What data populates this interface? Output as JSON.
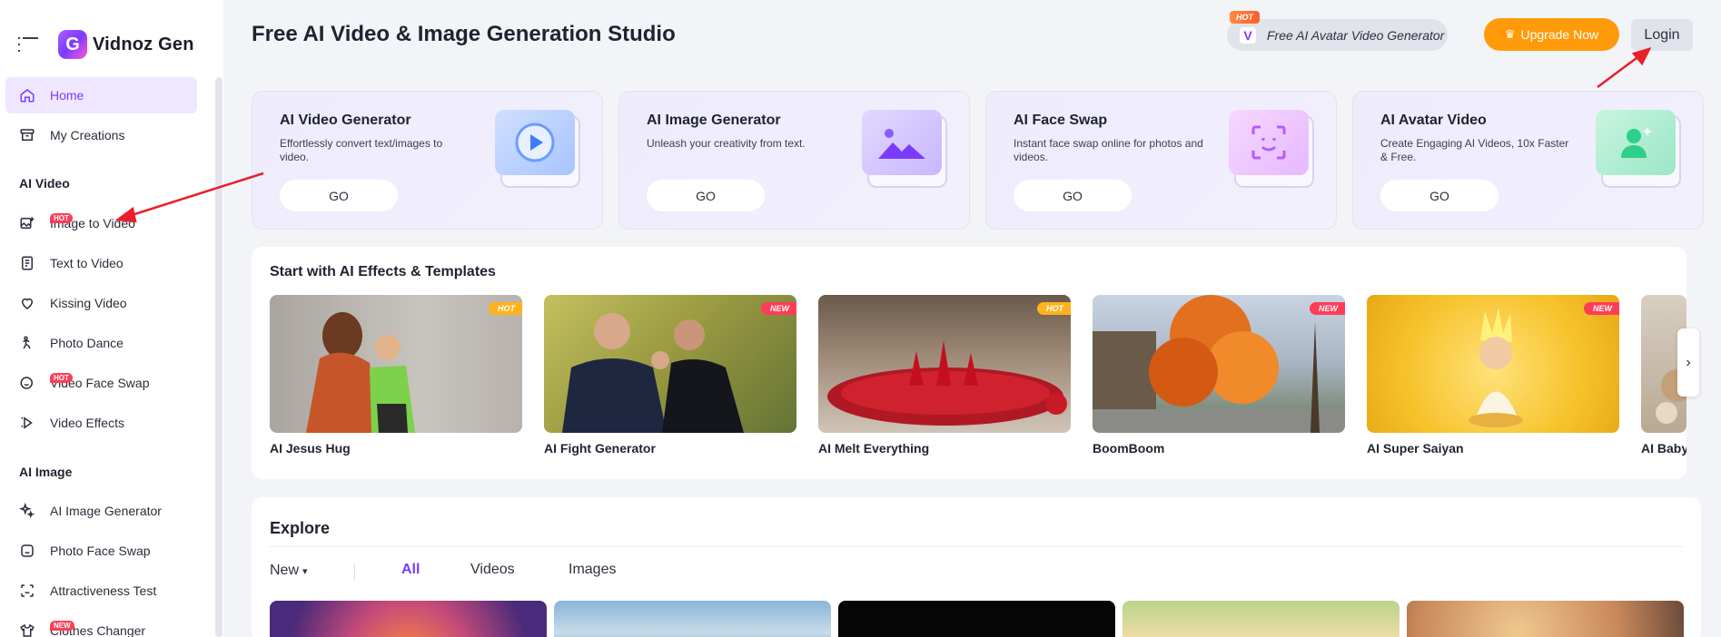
{
  "app": {
    "logo_letter": "G",
    "logo_text": "Vidnoz Gen",
    "accent": "#7a3bff"
  },
  "sidebar": {
    "items": [
      {
        "label": "Home",
        "icon": "home-icon",
        "active": true
      },
      {
        "label": "My Creations",
        "icon": "archive-icon"
      }
    ],
    "sections": [
      {
        "title": "AI Video",
        "items": [
          {
            "label": "Image to Video",
            "icon": "image-plus-icon",
            "badge": "HOT"
          },
          {
            "label": "Text to Video",
            "icon": "document-text-icon"
          },
          {
            "label": "Kissing Video",
            "icon": "heart-icon"
          },
          {
            "label": "Photo Dance",
            "icon": "person-dance-icon"
          },
          {
            "label": "Video Face Swap",
            "icon": "face-swap-icon",
            "badge": "HOT"
          },
          {
            "label": "Video Effects",
            "icon": "sparkle-video-icon"
          }
        ]
      },
      {
        "title": "AI Image",
        "items": [
          {
            "label": "AI Image Generator",
            "icon": "sparkles-icon"
          },
          {
            "label": "Photo Face Swap",
            "icon": "face-icon"
          },
          {
            "label": "Attractiveness Test",
            "icon": "scan-face-icon"
          },
          {
            "label": "Clothes Changer",
            "icon": "shirt-icon",
            "badge": "NEW"
          }
        ]
      }
    ]
  },
  "header": {
    "title": "Free AI Video & Image Generation Studio",
    "promo_badge": "HOT",
    "promo_label": "Free AI Avatar Video Generator",
    "upgrade_label": "Upgrade Now",
    "login_label": "Login"
  },
  "features": [
    {
      "title": "AI Video Generator",
      "desc": "Effortlessly convert text/images to video.",
      "go": "GO",
      "icon": "play-video-icon"
    },
    {
      "title": "AI Image Generator",
      "desc": "Unleash your creativity from text.",
      "go": "GO",
      "icon": "mountain-image-icon"
    },
    {
      "title": "AI Face Swap",
      "desc": "Instant face swap online for photos and videos.",
      "go": "GO",
      "icon": "smile-face-icon"
    },
    {
      "title": "AI Avatar Video",
      "desc": "Create Engaging AI Videos, 10x Faster & Free.",
      "go": "GO",
      "icon": "avatar-user-icon"
    }
  ],
  "effects": {
    "title": "Start with AI Effects & Templates",
    "items": [
      {
        "name": "AI Jesus Hug",
        "badge": "HOT"
      },
      {
        "name": "AI Fight Generator",
        "badge": "NEW"
      },
      {
        "name": "AI Melt Everything",
        "badge": "HOT"
      },
      {
        "name": "BoomBoom",
        "badge": "NEW"
      },
      {
        "name": "AI Super Saiyan",
        "badge": "NEW"
      },
      {
        "name": "AI Baby",
        "badge": ""
      }
    ],
    "next_icon": "chevron-right-icon"
  },
  "explore": {
    "title": "Explore",
    "sort_label": "New",
    "tabs": [
      {
        "label": "All",
        "active": true
      },
      {
        "label": "Videos"
      },
      {
        "label": "Images"
      }
    ]
  }
}
